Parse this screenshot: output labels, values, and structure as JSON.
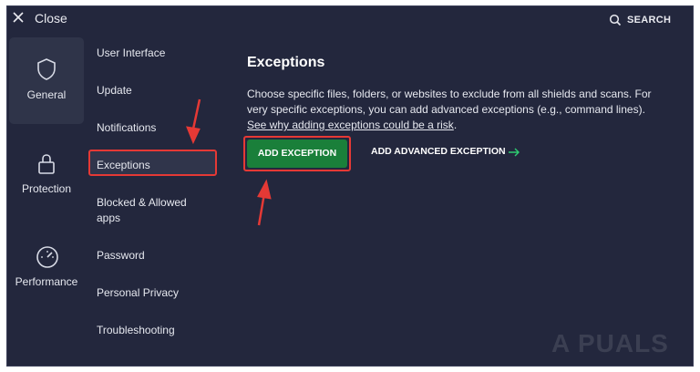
{
  "header": {
    "close_label": "Close",
    "search_label": "SEARCH"
  },
  "categories": [
    {
      "label": "General",
      "icon": "shield-icon",
      "selected": true
    },
    {
      "label": "Protection",
      "icon": "lock-icon",
      "selected": false
    },
    {
      "label": "Performance",
      "icon": "speedometer-icon",
      "selected": false
    }
  ],
  "submenu": [
    {
      "label": "User Interface"
    },
    {
      "label": "Update"
    },
    {
      "label": "Notifications"
    },
    {
      "label": "Exceptions",
      "selected": true
    },
    {
      "label": "Blocked & Allowed apps"
    },
    {
      "label": "Password"
    },
    {
      "label": "Personal Privacy"
    },
    {
      "label": "Troubleshooting"
    }
  ],
  "content": {
    "title": "Exceptions",
    "description": "Choose specific files, folders, or websites to exclude from all shields and scans. For very specific exceptions, you can add advanced exceptions (e.g., command lines).",
    "link": "See why adding exceptions could be a risk",
    "link_suffix": ".",
    "add_exception_label": "ADD EXCEPTION",
    "add_advanced_label": "ADD ADVANCED EXCEPTION"
  },
  "watermark": "A PUALS",
  "colors": {
    "background": "#23273d",
    "accent_green": "#1a7f3a",
    "annotation_red": "#e53935"
  }
}
